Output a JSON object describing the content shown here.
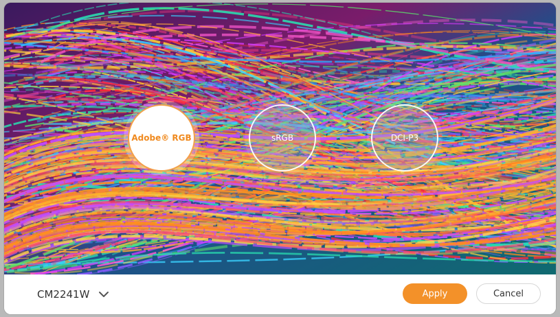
{
  "gamut_options": [
    {
      "label": "Adobe® RGB",
      "selected": true
    },
    {
      "label": "sRGB",
      "selected": false
    },
    {
      "label": "DCI-P3",
      "selected": false
    }
  ],
  "footer": {
    "model": "CM2241W",
    "apply_label": "Apply",
    "cancel_label": "Cancel"
  },
  "colors": {
    "accent": "#f39129",
    "selected_text": "#f08a1f"
  },
  "icons": {
    "model_dropdown": "chevron-down-icon"
  }
}
